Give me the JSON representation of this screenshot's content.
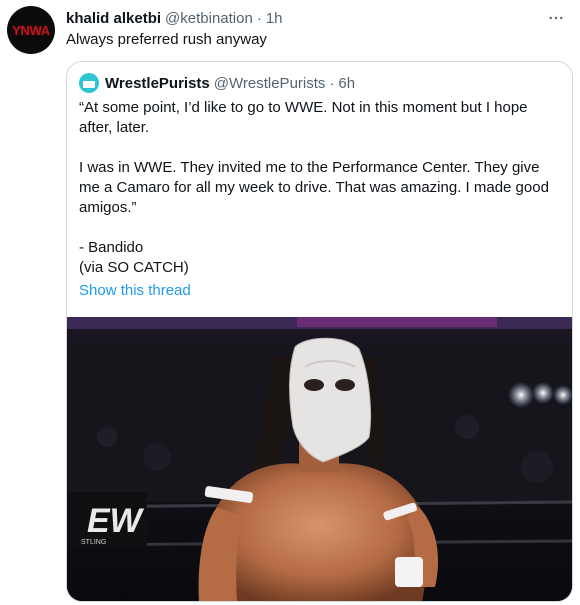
{
  "tweet": {
    "avatar_text": "YNWA",
    "display_name": "khalid alketbi",
    "handle": "@ketbination",
    "separator": "·",
    "time": "1h",
    "text": "Always preferred rush anyway",
    "more_icon": "more-horizontal-icon"
  },
  "quoted": {
    "display_name": "WrestlePurists",
    "handle": "@WrestlePurists",
    "separator": "·",
    "time": "6h",
    "lines": [
      "“At some point, I’d like to go to WWE. Not in this moment but I hope after, later.",
      "I was in WWE. They invited me to the Performance Center. They give me a Camaro for all my week to drive. That was amazing. I made good amigos.”",
      "- Bandido",
      "(via SO CATCH)"
    ],
    "show_thread": "Show this thread",
    "media": {
      "logo_text": "EW",
      "logo_subtext": "STLING"
    }
  },
  "colors": {
    "link": "#1d9bf0",
    "secondary_text": "#536471",
    "border": "#cfd9de",
    "avatar_red": "#c0141b"
  }
}
